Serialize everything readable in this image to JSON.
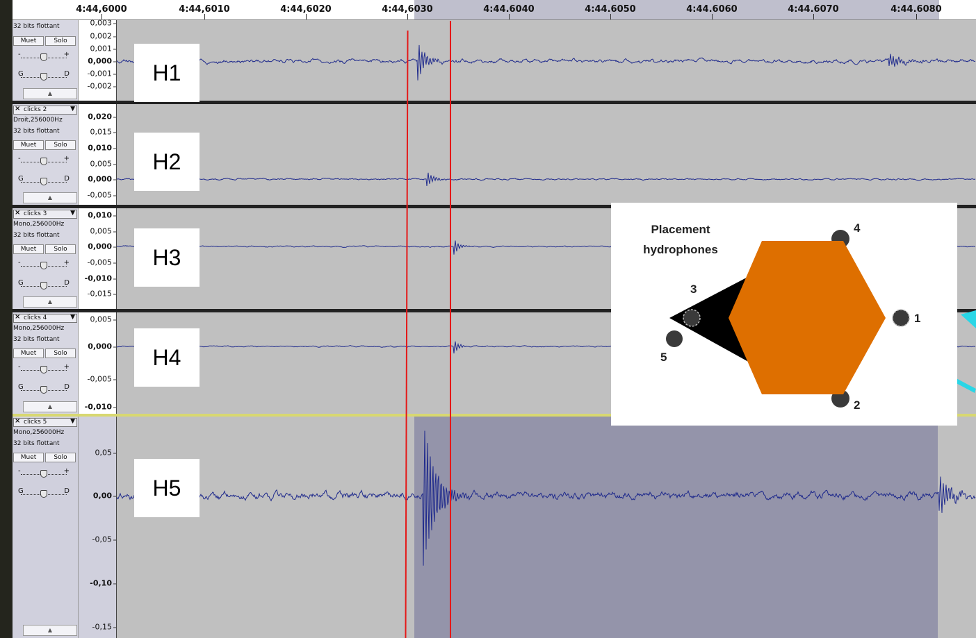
{
  "ruler": {
    "ticks": [
      "4:44,6000",
      "4:44,6010",
      "4:44,6020",
      "4:44,6030",
      "4:44.6040",
      "4:44.6050",
      "4:44.6060",
      "4:44.6070",
      "4:44.6080"
    ]
  },
  "common": {
    "mute_label": "Muet",
    "solo_label": "Solo",
    "pan_left": "G",
    "pan_right": "D",
    "gain_minus": "-",
    "gain_plus": "+"
  },
  "tracks": [
    {
      "name": "",
      "info1": "",
      "info2": "32 bits flottant",
      "overlay": "H1",
      "scale": [
        "0,003",
        "0,002",
        "0,001",
        "0,000",
        "-0,001",
        "-0,002"
      ],
      "bold_index": 3
    },
    {
      "name": "clicks 2",
      "info1": "Droit,256000Hz",
      "info2": "32 bits flottant",
      "overlay": "H2",
      "scale": [
        "0,020",
        "0,015",
        "0,010",
        "0,005",
        "0,000",
        "-0,005"
      ],
      "bold_indices": [
        0,
        2,
        4
      ]
    },
    {
      "name": "clicks 3",
      "info1": "Mono,256000Hz",
      "info2": "32 bits flottant",
      "overlay": "H3",
      "scale": [
        "0,010",
        "0,005",
        "0,000",
        "-0,005",
        "-0,010",
        "-0,015"
      ],
      "bold_indices": [
        0,
        2,
        4
      ]
    },
    {
      "name": "clicks 4",
      "info1": "Mono,256000Hz",
      "info2": "32 bits flottant",
      "overlay": "H4",
      "scale": [
        "0,005",
        "0,000",
        "-0,005",
        "-0,010"
      ],
      "bold_indices": [
        1,
        3
      ]
    },
    {
      "name": "clicks 5",
      "info1": "Mono,256000Hz",
      "info2": "32 bits flottant",
      "overlay": "H5",
      "scale": [
        "0,05",
        "0,00",
        "-0,05",
        "-0,10",
        "-0,15"
      ],
      "bold_indices": [
        1,
        3
      ]
    }
  ],
  "inset": {
    "title_line1": "Placement",
    "title_line2": "hydrophones",
    "hydrophones": [
      "1",
      "2",
      "3",
      "4",
      "5"
    ],
    "colors": {
      "hexagon": "#de6f00",
      "body": "#000000",
      "sensor": "#3a3a3a"
    }
  },
  "colors": {
    "waveform": "#1f2a8c",
    "selection": "#9494aa",
    "track_bg": "#c0c0c0",
    "markers": "#e41818",
    "arrows": "#2ad6e6"
  }
}
